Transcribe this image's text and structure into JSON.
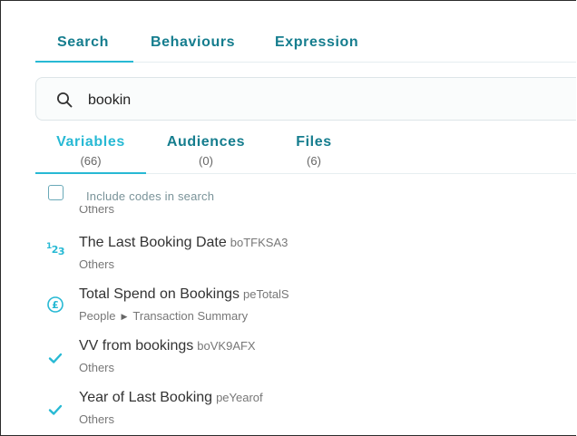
{
  "top_tabs": [
    "Search",
    "Behaviours",
    "Expression"
  ],
  "search": {
    "value": "bookin",
    "icon": "search-icon"
  },
  "sub_tabs": [
    {
      "label": "Variables",
      "count": "(66)"
    },
    {
      "label": "Audiences",
      "count": "(0)"
    },
    {
      "label": "Files",
      "count": "(6)"
    }
  ],
  "include_codes": {
    "label": "Include codes in search",
    "checked": false
  },
  "results": {
    "cut_off_text": "Others",
    "items": [
      {
        "title": "The Last Booking Date",
        "code": "boTFKSA3",
        "path": [
          "Others"
        ],
        "icon": "numeric-icon"
      },
      {
        "title": "Total Spend on Bookings",
        "code": "peTotalS",
        "path": [
          "People",
          "Transaction Summary"
        ],
        "icon": "currency-pound-icon"
      },
      {
        "title": "VV from bookings",
        "code": "boVK9AFX",
        "path": [
          "Others"
        ],
        "icon": "check-icon"
      },
      {
        "title": "Year of Last Booking",
        "code": "peYearof",
        "path": [
          "Others"
        ],
        "icon": "check-icon"
      }
    ]
  },
  "colors": {
    "accent": "#27b9d4",
    "tab_text": "#157d8e",
    "muted": "#777777"
  }
}
